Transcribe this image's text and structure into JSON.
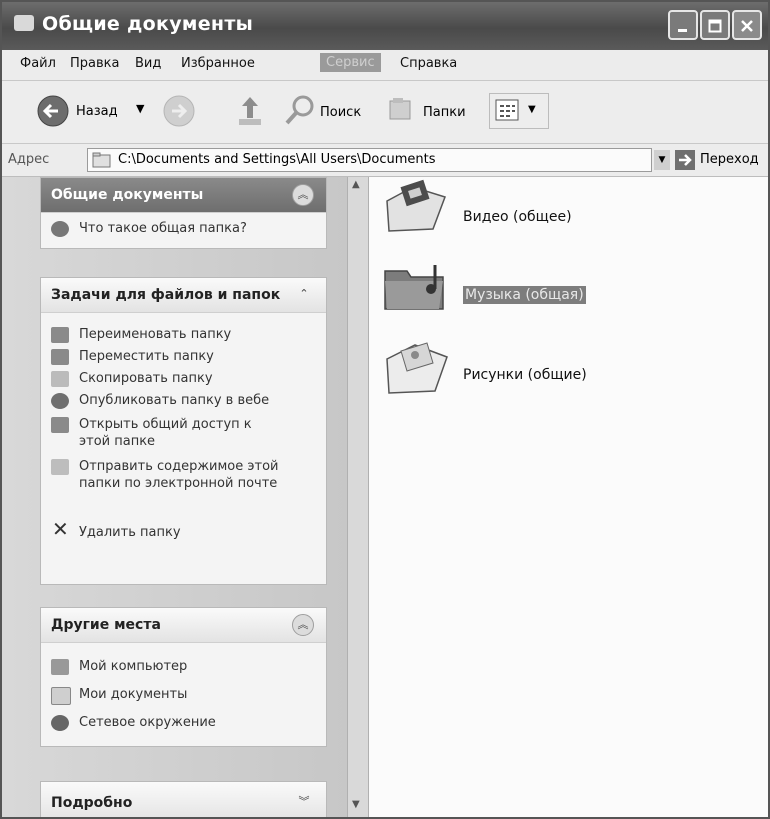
{
  "window": {
    "title": "Общие документы"
  },
  "menu": [
    {
      "label": "Файл"
    },
    {
      "label": "Правка"
    },
    {
      "label": "Вид"
    },
    {
      "label": "Избранное"
    },
    {
      "label": "Сервис"
    },
    {
      "label": "Справка"
    }
  ],
  "toolbar": {
    "back_label": "Назад",
    "search_label": "Поиск",
    "folders_label": "Папки"
  },
  "address": {
    "label": "Адрес",
    "value": "C:\\Documents and Settings\\All Users\\Documents",
    "go_label": "Переход"
  },
  "panels": {
    "shared": {
      "title": "Общие документы",
      "link": "Что такое общая папка?"
    },
    "tasks": {
      "title": "Задачи для файлов и папок",
      "items": [
        {
          "label": "Переименовать папку",
          "icon": "rename-icon"
        },
        {
          "label": "Переместить папку",
          "icon": "move-icon"
        },
        {
          "label": "Скопировать папку",
          "icon": "copy-icon"
        },
        {
          "label": "Опубликовать папку в вебе",
          "icon": "web-publish-icon"
        },
        {
          "label": "Открыть общий доступ к этой папке",
          "icon": "share-icon"
        },
        {
          "label": "Отправить содержимое этой папки по электронной почте",
          "icon": "email-icon"
        },
        {
          "label": "Удалить папку",
          "icon": "delete-icon"
        }
      ]
    },
    "places": {
      "title": "Другие места",
      "items": [
        {
          "label": "Мой компьютер",
          "icon": "computer-icon"
        },
        {
          "label": "Мои документы",
          "icon": "documents-icon"
        },
        {
          "label": "Сетевое окружение",
          "icon": "network-icon"
        }
      ]
    },
    "details": {
      "title": "Подробно"
    }
  },
  "folders": [
    {
      "label": "Видео (общее)",
      "icon": "video-folder-icon",
      "selected": false
    },
    {
      "label": "Музыка (общая)",
      "icon": "music-folder-icon",
      "selected": true
    },
    {
      "label": "Рисунки (общие)",
      "icon": "pictures-folder-icon",
      "selected": false
    }
  ]
}
